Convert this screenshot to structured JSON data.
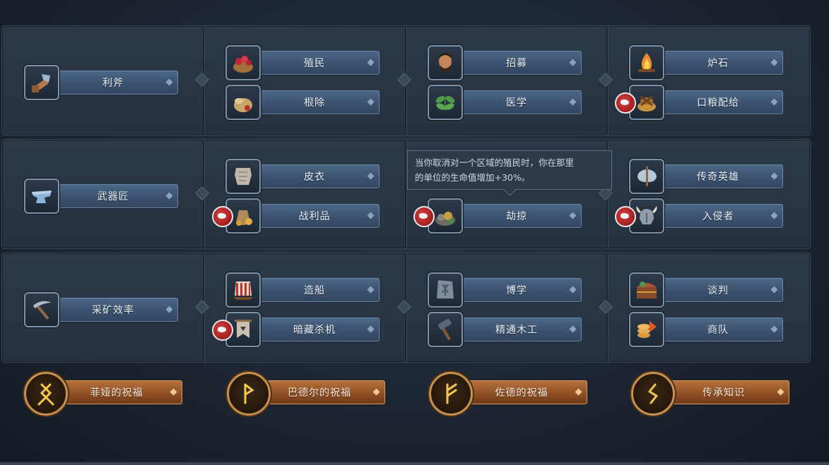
{
  "rows": [
    {
      "main": {
        "label": "利斧",
        "icon": "axe-icon"
      },
      "skills": [
        {
          "label": "殖民",
          "icon": "berry-basket-icon"
        },
        {
          "label": "根除",
          "icon": "grain-sack-icon"
        },
        {
          "label": "招募",
          "icon": "warrior-portrait-icon"
        },
        {
          "label": "医学",
          "icon": "herb-icon"
        },
        {
          "label": "炉石",
          "icon": "campfire-icon"
        },
        {
          "label": "口粮配给",
          "icon": "bread-ration-icon"
        }
      ]
    },
    {
      "main": {
        "label": "武器匠",
        "icon": "anvil-icon"
      },
      "skills": [
        {
          "label": "皮衣",
          "icon": "leather-hide-icon"
        },
        {
          "label": "战利品",
          "icon": "loot-bag-icon"
        },
        {
          "label": "劫掠",
          "icon": "ore-pile-icon"
        },
        {
          "label": "传奇英雄",
          "icon": "double-axe-icon"
        },
        {
          "label": "入侵者",
          "icon": "viking-helmet-icon"
        }
      ]
    },
    {
      "main": {
        "label": "采矿效率",
        "icon": "pickaxe-icon"
      },
      "skills": [
        {
          "label": "造船",
          "icon": "longship-sail-icon"
        },
        {
          "label": "暗藏杀机",
          "icon": "banner-icon"
        },
        {
          "label": "博学",
          "icon": "rune-stone-icon"
        },
        {
          "label": "精通木工",
          "icon": "hammer-icon"
        },
        {
          "label": "谈判",
          "icon": "trade-chest-icon"
        },
        {
          "label": "商队",
          "icon": "coins-icon"
        }
      ]
    }
  ],
  "tooltip": {
    "line1": "当你取消对一个区域的殖民时，你在那里",
    "line2": "的单位的生命值增加+30%。"
  },
  "blessings": [
    {
      "label": "菲娅的祝福",
      "icon": "rune-othala-icon"
    },
    {
      "label": "巴德尔的祝福",
      "icon": "rune-wunjo-icon"
    },
    {
      "label": "佐德的祝福",
      "icon": "rune-fehu-icon"
    },
    {
      "label": "传承知识",
      "icon": "rune-sowilo-icon"
    }
  ],
  "colors": {
    "background": "#1b2430",
    "skill_plate": "#3b5270",
    "blessing_plate": "#8d4e24",
    "requirement_badge": "#c02a2a"
  }
}
